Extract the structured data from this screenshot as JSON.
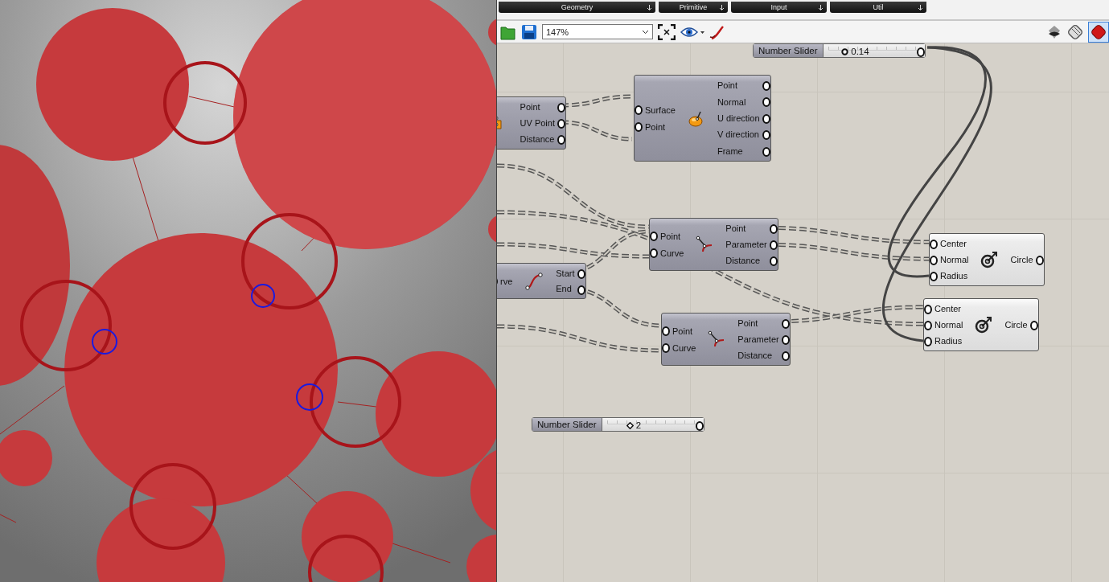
{
  "component_tabs": [
    {
      "label": "Geometry"
    },
    {
      "label": "Primitive"
    },
    {
      "label": "Input"
    },
    {
      "label": "Util"
    }
  ],
  "toolbar": {
    "zoom": "147%"
  },
  "sliders": [
    {
      "title": "Number Slider",
      "kind": "float",
      "value": "0.14",
      "level": 0.18
    },
    {
      "title": "Number Slider",
      "kind": "integer",
      "value": "2",
      "level": 0.24
    }
  ],
  "components": [
    {
      "kind": "surface-point",
      "outputs": [
        "Point",
        "UV Point",
        "Distance"
      ]
    },
    {
      "kind": "evaluate-surface",
      "inputs": [
        "Surface",
        "Point"
      ],
      "outputs": [
        "Point",
        "Normal",
        "U direction",
        "V direction",
        "Frame"
      ]
    },
    {
      "kind": "curve-closest",
      "inputs": [
        "Point",
        "Curve"
      ],
      "outputs": [
        "Point",
        "Parameter",
        "Distance"
      ]
    },
    {
      "kind": "curve-ends",
      "inputs": [
        "rve"
      ],
      "outputs": [
        "Start",
        "End"
      ]
    },
    {
      "kind": "curve-closest",
      "inputs": [
        "Point",
        "Curve"
      ],
      "outputs": [
        "Point",
        "Parameter",
        "Distance"
      ]
    },
    {
      "kind": "circle",
      "inputs": [
        "Center",
        "Normal",
        "Radius"
      ],
      "outputs": [
        "Circle"
      ]
    },
    {
      "kind": "circle",
      "inputs": [
        "Center",
        "Normal",
        "Radius"
      ],
      "outputs": [
        "Circle"
      ]
    }
  ]
}
